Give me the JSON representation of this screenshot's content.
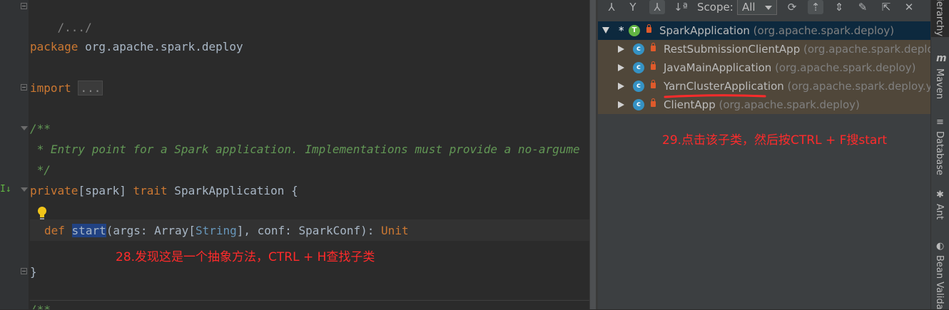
{
  "editor": {
    "lines": {
      "header_fold": "/.../",
      "package_kw": "package",
      "package_name": " org.apache.spark.deploy",
      "import_kw": "import",
      "import_collapsed": "...",
      "doc_open": "/**",
      "doc_text": " * Entry point for a Spark application. Implementations must provide a no-argume",
      "doc_close": " */",
      "trait_private": "private",
      "trait_bracket": "[spark] ",
      "trait_kw": "trait",
      "trait_rest": " SparkApplication {",
      "def_kw": "def",
      "def_name": "start",
      "def_args1": "(args: Array[",
      "def_string": "String",
      "def_args2": "], conf: SparkConf): ",
      "def_unit": "Unit",
      "close_brace": "}",
      "bottom_doc": "/**"
    },
    "annotation_28": "28.发现这是一个抽象方法，CTRL + H查找子类"
  },
  "hierarchy": {
    "toolbar": {
      "scope_label": "Scope:",
      "scope_value": "All"
    },
    "tree": {
      "root": {
        "name": "SparkApplication",
        "pkg": " (org.apache.spark.deploy)"
      },
      "children": [
        {
          "name": "RestSubmissionClientApp",
          "pkg": " (org.apache.spark.deploy"
        },
        {
          "name": "JavaMainApplication",
          "pkg": " (org.apache.spark.deploy)"
        },
        {
          "name": "YarnClusterApplication",
          "pkg": " (org.apache.spark.deploy.ya"
        },
        {
          "name": "ClientApp",
          "pkg": " (org.apache.spark.deploy)"
        }
      ]
    },
    "annotation_29": "29.点击该子类，然后按CTRL + F搜start"
  },
  "stripe": {
    "hierarchy": "ierarchy",
    "maven": "Maven",
    "database": "Database",
    "ant": "Ant",
    "bean": "Bean Valida"
  },
  "colors": {
    "annotation": "#ff2b2b",
    "keyword": "#cc7832",
    "doc_comment": "#629755",
    "selection": "#214283"
  }
}
